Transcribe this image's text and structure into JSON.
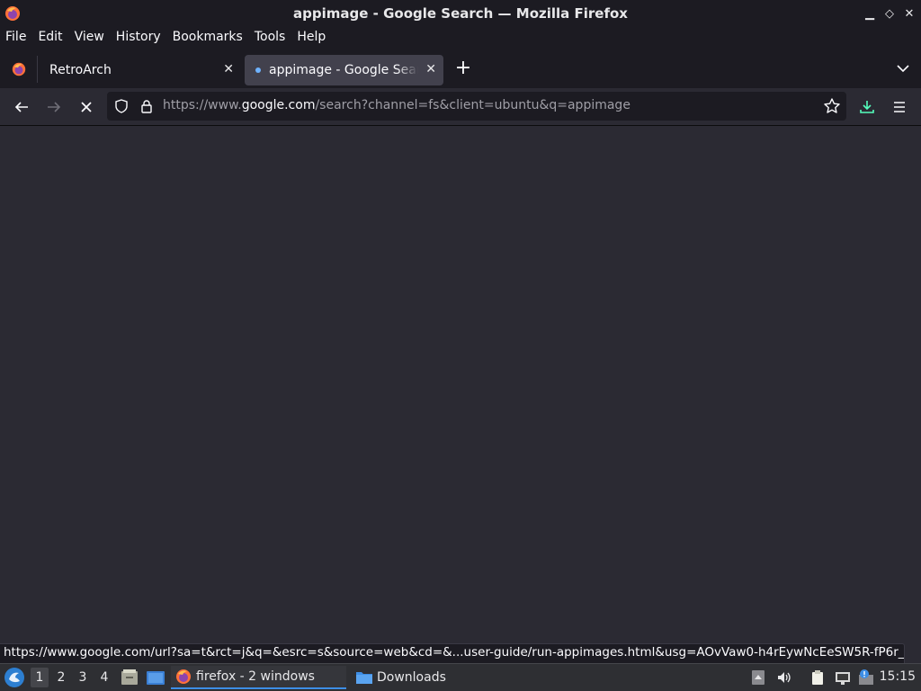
{
  "window": {
    "title": "appimage - Google Search — Mozilla Firefox"
  },
  "menu": {
    "items": [
      "File",
      "Edit",
      "View",
      "History",
      "Bookmarks",
      "Tools",
      "Help"
    ]
  },
  "tabs": [
    {
      "label": "RetroArch",
      "active": false
    },
    {
      "label": "appimage - Google Search",
      "active": true,
      "loading": true
    }
  ],
  "navbar": {
    "url_prefix": "https://www.",
    "url_domain": "google.com",
    "url_rest": "/search?channel=fs&client=ubuntu&q=appimage"
  },
  "status": {
    "link": "https://www.google.com/url?sa=t&rct=j&q=&esrc=s&source=web&cd=&...user-guide/run-appimages.html&usg=AOvVaw0-h4rEywNcEeSW5R-fP6r_"
  },
  "taskbar": {
    "workspaces": [
      "1",
      "2",
      "3",
      "4"
    ],
    "active_workspace": "1",
    "tasks": [
      {
        "label": "firefox - 2 windows",
        "icon": "firefox-icon",
        "active": true
      },
      {
        "label": "Downloads",
        "icon": "folder-icon",
        "active": false
      }
    ],
    "clock": "15:15"
  },
  "colors": {
    "accent": "#3d8ee6",
    "download_icon": "#54ffbd"
  }
}
